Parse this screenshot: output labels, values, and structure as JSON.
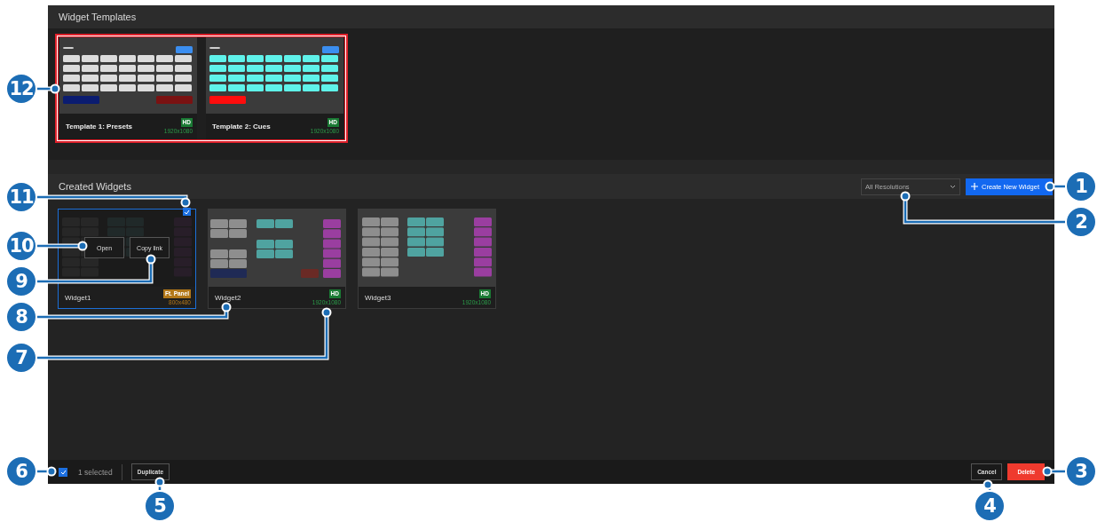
{
  "templates_panel": {
    "title": "Widget Templates"
  },
  "templates": [
    {
      "title": "Template 1: Presets",
      "badge": "HD",
      "resolution": "1920x1080"
    },
    {
      "title": "Template 2: Cues",
      "badge": "HD",
      "resolution": "1920x1080"
    }
  ],
  "widgets_panel": {
    "title": "Created Widgets",
    "filter": "All Resolutions",
    "create_button": "Create New Widget"
  },
  "widgets": [
    {
      "name": "Widget1",
      "selected": true,
      "badge": "Ft. Panel",
      "kind": "panel",
      "resolution": "800x480",
      "actions": [
        "Open",
        "Copy link"
      ]
    },
    {
      "name": "Widget2",
      "selected": false,
      "badge": "HD",
      "kind": "hd",
      "resolution": "1920x1080"
    },
    {
      "name": "Widget3",
      "selected": false,
      "badge": "HD",
      "kind": "hd",
      "resolution": "1920x1080"
    }
  ],
  "footer": {
    "all_checked": true,
    "selection": "1 selected",
    "duplicate": "Duplicate",
    "cancel": "Cancel",
    "delete": "Delete"
  },
  "callouts": [
    {
      "number": "12"
    },
    {
      "number": "1"
    },
    {
      "number": "11"
    },
    {
      "number": "2"
    },
    {
      "number": "10"
    },
    {
      "number": "9"
    },
    {
      "number": "8"
    },
    {
      "number": "7"
    },
    {
      "number": "6"
    },
    {
      "number": "3"
    },
    {
      "number": "5"
    },
    {
      "number": "4"
    }
  ]
}
